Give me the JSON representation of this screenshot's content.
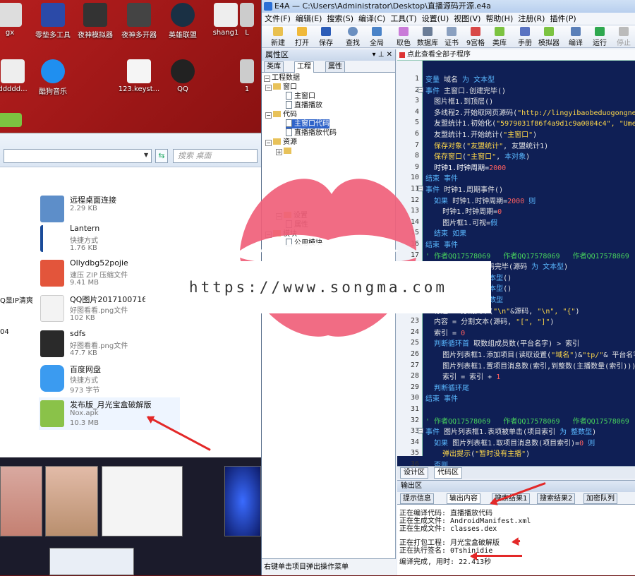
{
  "desktop": {
    "icons": [
      {
        "label": "gx"
      },
      {
        "label": "零垫多工具"
      },
      {
        "label": "夜神模拟器"
      },
      {
        "label": "夜神多开器"
      },
      {
        "label": "英雄联盟"
      },
      {
        "label": "shang1"
      },
      {
        "label": "L"
      },
      {
        "label": "ddddd..."
      },
      {
        "label": "酷狗音乐"
      },
      {
        "label": "123.keyst..."
      },
      {
        "label": "QQ"
      },
      {
        "label": "1"
      }
    ]
  },
  "explorer": {
    "search_placeholder": "搜索 桌面",
    "side_labels": [
      "Q显IP清爽",
      "04"
    ],
    "files": [
      {
        "name": "远程桌面连接",
        "type": "",
        "size": "2.29 KB"
      },
      {
        "name": "Lantern",
        "type": "快捷方式",
        "size": "1.76 KB"
      },
      {
        "name": "Ollydbg52pojie",
        "type": "速压 ZIP 压缩文件",
        "size": "9.41 MB"
      },
      {
        "name": "QQ图片20171007165​25",
        "type": "好图看看.png文件",
        "size": "102 KB"
      },
      {
        "name": "sdfs",
        "type": "好图看看.png文件",
        "size": "47.7 KB"
      },
      {
        "name": "百度网盘",
        "type": "快捷方式",
        "size": "973 字节"
      },
      {
        "name": "发布版_月光宝盒破解版",
        "type": "Nox.apk",
        "size": "10.3 MB"
      }
    ]
  },
  "ide": {
    "title": "E4A — C:\\Users\\Administrator\\Desktop\\直播源码开源.e4a",
    "menu": [
      "文件(F)",
      "编辑(E)",
      "搜索(S)",
      "编译(C)",
      "工具(T)",
      "设置(U)",
      "视图(V)",
      "帮助(H)",
      "注册(R)",
      "插件(P)"
    ],
    "toolbar": [
      "新建",
      "打开",
      "保存",
      "查找",
      "全局",
      "取色",
      "数据库",
      "证书",
      "9宫格",
      "类库",
      "手册",
      "模拟器",
      "编译",
      "运行",
      "停止"
    ],
    "left_panel": {
      "title": "属性区",
      "tabs": [
        "类库",
        "工程",
        "属性"
      ],
      "tree": [
        "工程数据",
        "窗口",
        "主窗口",
        "直播播放",
        "代码",
        "主窗口代码",
        "直播播放代码",
        "资源",
        "设置",
        "属性",
        "模块",
        "公用模块"
      ],
      "status": "右键单击项目弹出操作菜单"
    },
    "editor": {
      "header": "点此查看全部子程序",
      "tabs": [
        "设计区",
        "代码区"
      ]
    },
    "output": {
      "title": "输出区",
      "tabs": [
        "提示信息",
        "输出内容",
        "搜索结果1",
        "搜索结果2",
        "加密队列"
      ],
      "lines": [
        "正在编译代码: 直播播放代码",
        "正在生成文件: AndroidManifest.xml",
        "正在生成文件: classes.dex",
        "",
        "正在打包工程: 月光宝盒破解版",
        "正在执行签名: 0Tshinidie",
        "",
        "编译完成, 用时: 22.413秒"
      ]
    }
  },
  "watermark": "https://www.songma.com",
  "colors": {
    "editor_bg": "#0f1f55",
    "keyword": "#5ab8ff",
    "string": "#ffd84a",
    "comment": "#47d25d",
    "arrow": "#e32828",
    "lips": "#f0607a"
  }
}
